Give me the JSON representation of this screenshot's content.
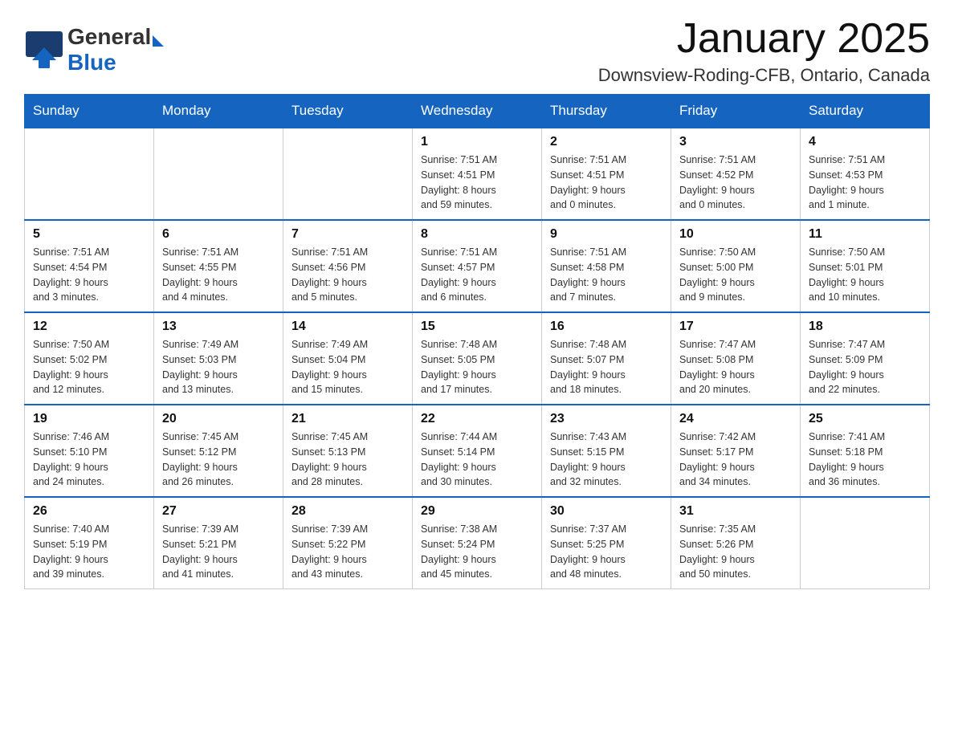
{
  "header": {
    "logo_general": "General",
    "logo_blue": "Blue",
    "month_title": "January 2025",
    "location": "Downsview-Roding-CFB, Ontario, Canada"
  },
  "days_of_week": [
    "Sunday",
    "Monday",
    "Tuesday",
    "Wednesday",
    "Thursday",
    "Friday",
    "Saturday"
  ],
  "weeks": [
    [
      {
        "num": "",
        "info": ""
      },
      {
        "num": "",
        "info": ""
      },
      {
        "num": "",
        "info": ""
      },
      {
        "num": "1",
        "info": "Sunrise: 7:51 AM\nSunset: 4:51 PM\nDaylight: 8 hours\nand 59 minutes."
      },
      {
        "num": "2",
        "info": "Sunrise: 7:51 AM\nSunset: 4:51 PM\nDaylight: 9 hours\nand 0 minutes."
      },
      {
        "num": "3",
        "info": "Sunrise: 7:51 AM\nSunset: 4:52 PM\nDaylight: 9 hours\nand 0 minutes."
      },
      {
        "num": "4",
        "info": "Sunrise: 7:51 AM\nSunset: 4:53 PM\nDaylight: 9 hours\nand 1 minute."
      }
    ],
    [
      {
        "num": "5",
        "info": "Sunrise: 7:51 AM\nSunset: 4:54 PM\nDaylight: 9 hours\nand 3 minutes."
      },
      {
        "num": "6",
        "info": "Sunrise: 7:51 AM\nSunset: 4:55 PM\nDaylight: 9 hours\nand 4 minutes."
      },
      {
        "num": "7",
        "info": "Sunrise: 7:51 AM\nSunset: 4:56 PM\nDaylight: 9 hours\nand 5 minutes."
      },
      {
        "num": "8",
        "info": "Sunrise: 7:51 AM\nSunset: 4:57 PM\nDaylight: 9 hours\nand 6 minutes."
      },
      {
        "num": "9",
        "info": "Sunrise: 7:51 AM\nSunset: 4:58 PM\nDaylight: 9 hours\nand 7 minutes."
      },
      {
        "num": "10",
        "info": "Sunrise: 7:50 AM\nSunset: 5:00 PM\nDaylight: 9 hours\nand 9 minutes."
      },
      {
        "num": "11",
        "info": "Sunrise: 7:50 AM\nSunset: 5:01 PM\nDaylight: 9 hours\nand 10 minutes."
      }
    ],
    [
      {
        "num": "12",
        "info": "Sunrise: 7:50 AM\nSunset: 5:02 PM\nDaylight: 9 hours\nand 12 minutes."
      },
      {
        "num": "13",
        "info": "Sunrise: 7:49 AM\nSunset: 5:03 PM\nDaylight: 9 hours\nand 13 minutes."
      },
      {
        "num": "14",
        "info": "Sunrise: 7:49 AM\nSunset: 5:04 PM\nDaylight: 9 hours\nand 15 minutes."
      },
      {
        "num": "15",
        "info": "Sunrise: 7:48 AM\nSunset: 5:05 PM\nDaylight: 9 hours\nand 17 minutes."
      },
      {
        "num": "16",
        "info": "Sunrise: 7:48 AM\nSunset: 5:07 PM\nDaylight: 9 hours\nand 18 minutes."
      },
      {
        "num": "17",
        "info": "Sunrise: 7:47 AM\nSunset: 5:08 PM\nDaylight: 9 hours\nand 20 minutes."
      },
      {
        "num": "18",
        "info": "Sunrise: 7:47 AM\nSunset: 5:09 PM\nDaylight: 9 hours\nand 22 minutes."
      }
    ],
    [
      {
        "num": "19",
        "info": "Sunrise: 7:46 AM\nSunset: 5:10 PM\nDaylight: 9 hours\nand 24 minutes."
      },
      {
        "num": "20",
        "info": "Sunrise: 7:45 AM\nSunset: 5:12 PM\nDaylight: 9 hours\nand 26 minutes."
      },
      {
        "num": "21",
        "info": "Sunrise: 7:45 AM\nSunset: 5:13 PM\nDaylight: 9 hours\nand 28 minutes."
      },
      {
        "num": "22",
        "info": "Sunrise: 7:44 AM\nSunset: 5:14 PM\nDaylight: 9 hours\nand 30 minutes."
      },
      {
        "num": "23",
        "info": "Sunrise: 7:43 AM\nSunset: 5:15 PM\nDaylight: 9 hours\nand 32 minutes."
      },
      {
        "num": "24",
        "info": "Sunrise: 7:42 AM\nSunset: 5:17 PM\nDaylight: 9 hours\nand 34 minutes."
      },
      {
        "num": "25",
        "info": "Sunrise: 7:41 AM\nSunset: 5:18 PM\nDaylight: 9 hours\nand 36 minutes."
      }
    ],
    [
      {
        "num": "26",
        "info": "Sunrise: 7:40 AM\nSunset: 5:19 PM\nDaylight: 9 hours\nand 39 minutes."
      },
      {
        "num": "27",
        "info": "Sunrise: 7:39 AM\nSunset: 5:21 PM\nDaylight: 9 hours\nand 41 minutes."
      },
      {
        "num": "28",
        "info": "Sunrise: 7:39 AM\nSunset: 5:22 PM\nDaylight: 9 hours\nand 43 minutes."
      },
      {
        "num": "29",
        "info": "Sunrise: 7:38 AM\nSunset: 5:24 PM\nDaylight: 9 hours\nand 45 minutes."
      },
      {
        "num": "30",
        "info": "Sunrise: 7:37 AM\nSunset: 5:25 PM\nDaylight: 9 hours\nand 48 minutes."
      },
      {
        "num": "31",
        "info": "Sunrise: 7:35 AM\nSunset: 5:26 PM\nDaylight: 9 hours\nand 50 minutes."
      },
      {
        "num": "",
        "info": ""
      }
    ]
  ]
}
